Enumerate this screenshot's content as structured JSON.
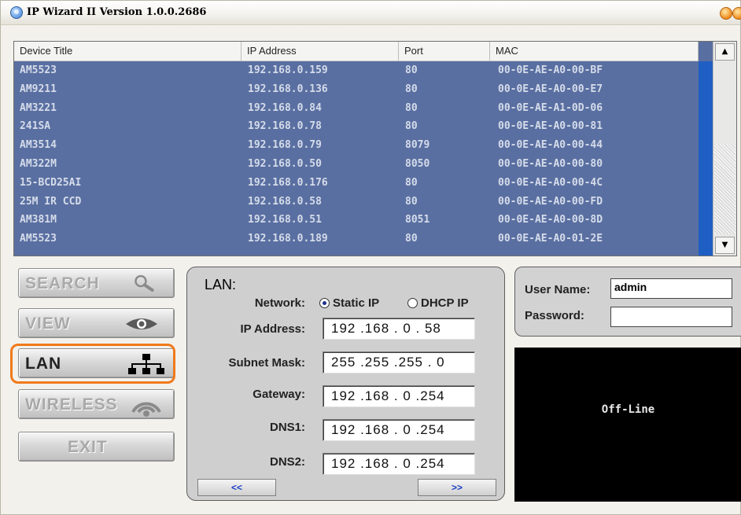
{
  "window": {
    "title": "IP Wizard II  Version 1.0.0.2686"
  },
  "device_list": {
    "columns": [
      "Device Title",
      "IP Address",
      "Port",
      "MAC"
    ],
    "rows": [
      [
        "AM5523",
        "192.168.0.159",
        "80",
        "00-0E-AE-A0-00-BF"
      ],
      [
        "AM9211",
        "192.168.0.136",
        "80",
        "00-0E-AE-A0-00-E7"
      ],
      [
        "AM3221",
        "192.168.0.84",
        "80",
        "00-0E-AE-A1-0D-06"
      ],
      [
        "241SA",
        "192.168.0.78",
        "80",
        "00-0E-AE-A0-00-81"
      ],
      [
        "AM3514",
        "192.168.0.79",
        "8079",
        "00-0E-AE-A0-00-44"
      ],
      [
        "AM322M",
        "192.168.0.50",
        "8050",
        "00-0E-AE-A0-00-80"
      ],
      [
        "15-BCD25AI",
        "192.168.0.176",
        "80",
        "00-0E-AE-A0-00-4C"
      ],
      [
        "25M IR CCD",
        "192.168.0.58",
        "80",
        "00-0E-AE-A0-00-FD"
      ],
      [
        "AM381M",
        "192.168.0.51",
        "8051",
        "00-0E-AE-A0-00-8D"
      ],
      [
        "AM5523",
        "192.168.0.189",
        "80",
        "00-0E-AE-A0-01-2E"
      ]
    ],
    "scroll_up_icon": "triangle-up",
    "scroll_down_icon": "triangle-down"
  },
  "nav": {
    "search": {
      "label": "SEARCH",
      "icon": "magnifier-icon"
    },
    "view": {
      "label": "VIEW",
      "icon": "eye-icon"
    },
    "lan": {
      "label": "LAN",
      "icon": "network-icon",
      "selected": true
    },
    "wireless": {
      "label": "WIRELESS",
      "icon": "wifi-icon"
    },
    "exit": {
      "label": "EXIT"
    }
  },
  "lan_panel": {
    "title": "LAN:",
    "network_label": "Network:",
    "static_ip_label": "Static IP",
    "dhcp_ip_label": "DHCP IP",
    "network_mode": "Static IP",
    "ip_label": "IP Address:",
    "ip_value": "192 .168 .  0  . 58",
    "subnet_label": "Subnet Mask:",
    "subnet_value": "255 .255 .255 .  0",
    "gateway_label": "Gateway:",
    "gateway_value": "192 .168 .  0  .254",
    "dns1_label": "DNS1:",
    "dns1_value": "192 .168 .  0  .254",
    "dns2_label": "DNS2:",
    "dns2_value": "192 .168 .  0  .254",
    "prev_label": "<<",
    "next_label": ">>"
  },
  "login": {
    "username_label": "User Name:",
    "username_value": "admin",
    "password_label": "Password:",
    "password_value": ""
  },
  "status": {
    "text": "Off-Line"
  },
  "colors": {
    "list_bg": "#5a6fa1",
    "selection": "#1f5fc3",
    "highlight": "#f07a1a",
    "status_bg": "#000000"
  }
}
